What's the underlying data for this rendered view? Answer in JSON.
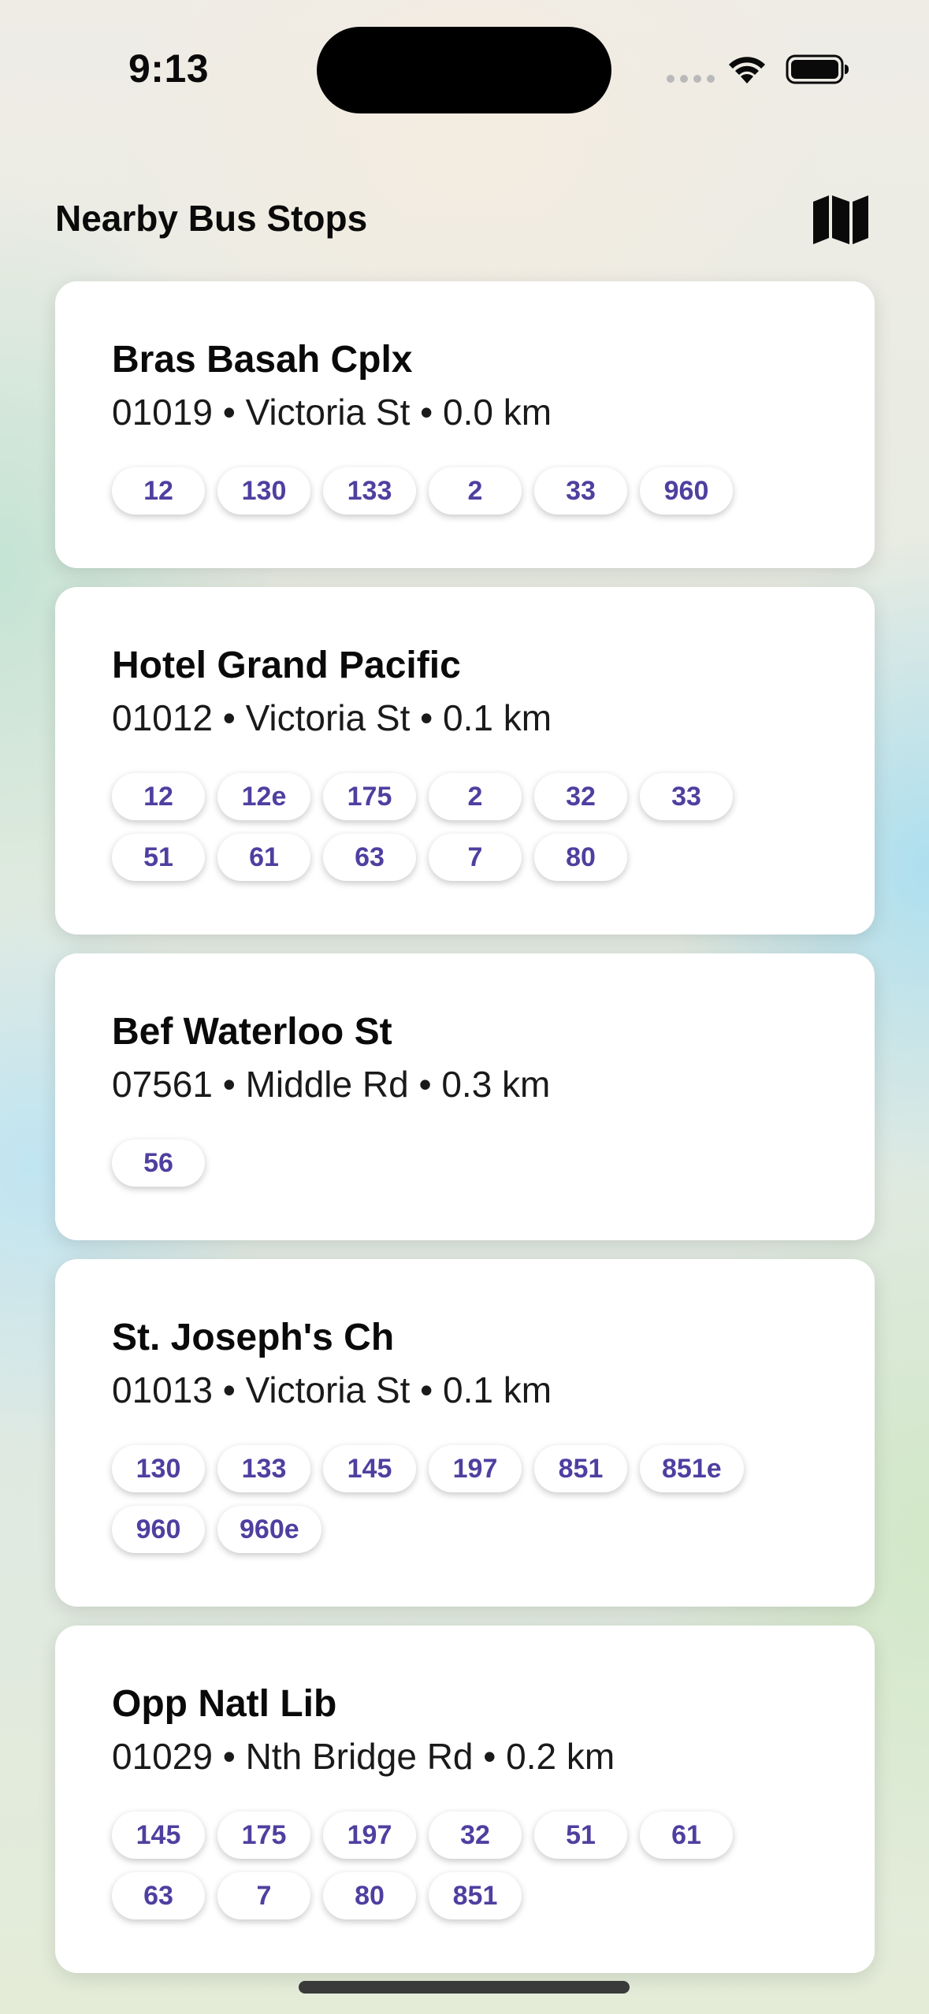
{
  "status_bar": {
    "time": "9:13"
  },
  "header": {
    "title": "Nearby Bus Stops",
    "map_icon": "map-icon"
  },
  "stops": [
    {
      "name": "Bras Basah Cplx",
      "detail": "01019 • Victoria St • 0.0 km",
      "services": [
        "12",
        "130",
        "133",
        "2",
        "33",
        "960"
      ]
    },
    {
      "name": "Hotel Grand Pacific",
      "detail": "01012 • Victoria St • 0.1 km",
      "services": [
        "12",
        "12e",
        "175",
        "2",
        "32",
        "33",
        "51",
        "61",
        "63",
        "7",
        "80"
      ]
    },
    {
      "name": "Bef Waterloo St",
      "detail": "07561 • Middle Rd • 0.3 km",
      "services": [
        "56"
      ]
    },
    {
      "name": "St. Joseph's Ch",
      "detail": "01013 • Victoria St • 0.1 km",
      "services": [
        "130",
        "133",
        "145",
        "197",
        "851",
        "851e",
        "960",
        "960e"
      ]
    },
    {
      "name": "Opp Natl Lib",
      "detail": "01029 • Nth Bridge Rd • 0.2 km",
      "services": [
        "145",
        "175",
        "197",
        "32",
        "51",
        "61",
        "63",
        "7",
        "80",
        "851"
      ]
    }
  ],
  "colors": {
    "accent": "#4f3fa0",
    "card": "#ffffff",
    "text": "#0a0a0a"
  }
}
